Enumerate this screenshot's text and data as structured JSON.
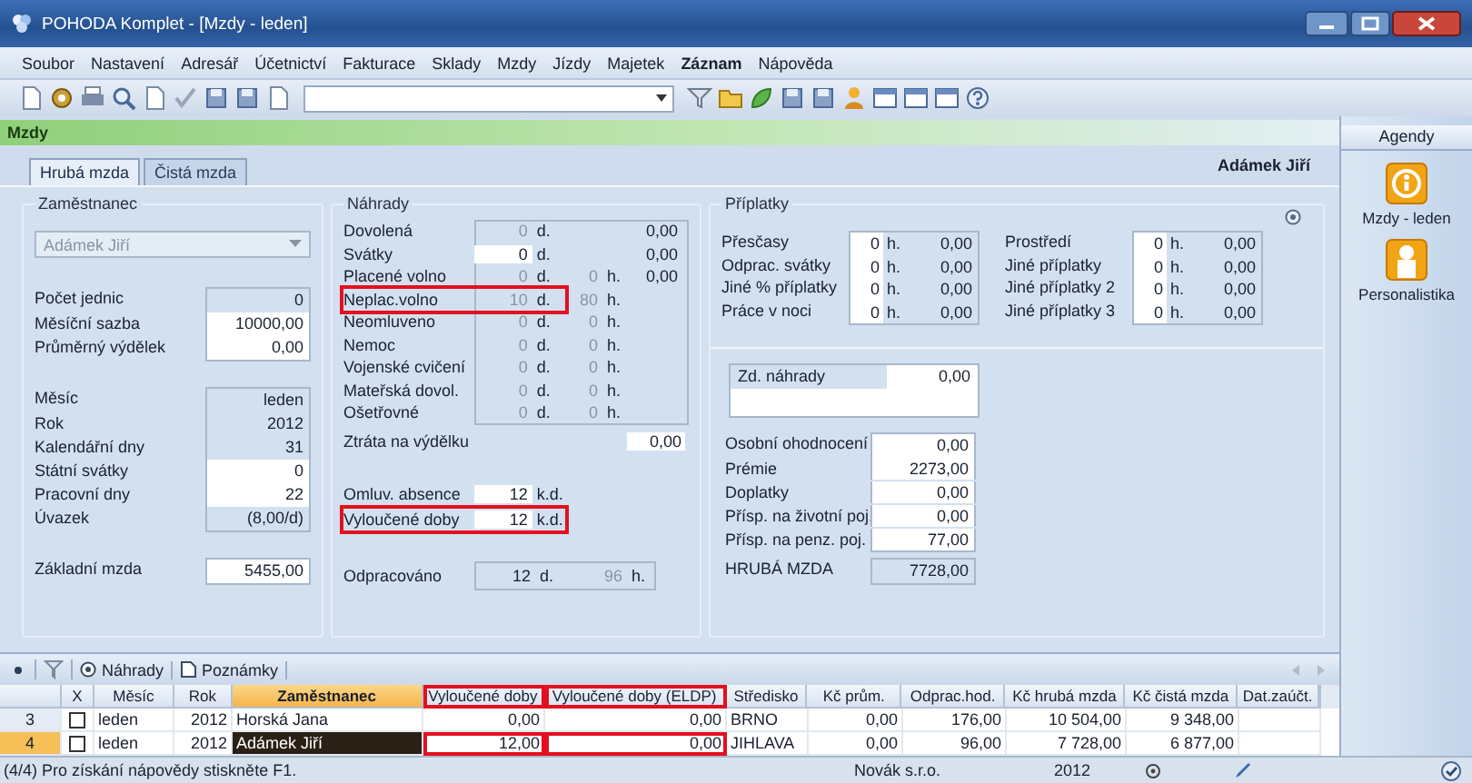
{
  "window": {
    "title": "POHODA Komplet - [Mzdy - leden]"
  },
  "menu": [
    {
      "label": "Soubor",
      "bold": false
    },
    {
      "label": "Nastavení",
      "bold": false
    },
    {
      "label": "Adresář",
      "bold": false
    },
    {
      "label": "Účetnictví",
      "bold": false
    },
    {
      "label": "Fakturace",
      "bold": false
    },
    {
      "label": "Sklady",
      "bold": false
    },
    {
      "label": "Mzdy",
      "bold": false
    },
    {
      "label": "Jízdy",
      "bold": false
    },
    {
      "label": "Majetek",
      "bold": false
    },
    {
      "label": "Záznam",
      "bold": true
    },
    {
      "label": "Nápověda",
      "bold": false
    }
  ],
  "agenda_header": "Mzdy",
  "tabs": [
    {
      "label": "Hrubá mzda",
      "selected": true
    },
    {
      "label": "Čistá mzda",
      "selected": false
    }
  ],
  "employee_name": "Adámek Jiří",
  "employee": {
    "title": "Zaměstnanec",
    "select_value": "Adámek Jiří",
    "fields_a": [
      {
        "label": "Počet jednic",
        "value": "0",
        "editable": false
      },
      {
        "label": "Měsíční sazba",
        "value": "10000,00",
        "editable": true
      },
      {
        "label": "Průměrný výdělek",
        "value": "0,00",
        "editable": true
      }
    ],
    "fields_b": [
      {
        "label": "Měsíc",
        "value": "leden",
        "editable": false
      },
      {
        "label": "Rok",
        "value": "2012",
        "editable": false
      },
      {
        "label": "Kalendářní dny",
        "value": "31",
        "editable": false
      },
      {
        "label": "Státní svátky",
        "value": "0",
        "editable": true
      },
      {
        "label": "Pracovní dny",
        "value": "22",
        "editable": true
      },
      {
        "label": "Úvazek",
        "value": "(8,00/d)",
        "editable": false
      }
    ],
    "base": {
      "label": "Základní mzda",
      "value": "5455,00"
    }
  },
  "compensation": {
    "title": "Náhrady",
    "rows": [
      {
        "label": "Dovolená",
        "days": "0",
        "day_unit": "d.",
        "amount": "0,00",
        "editable": false,
        "highlighted": false
      },
      {
        "label": "Svátky",
        "days": "0",
        "day_unit": "d.",
        "amount": "0,00",
        "editable": true,
        "highlighted": false
      },
      {
        "label": "Placené volno",
        "days": "0",
        "day_unit": "d.",
        "hours": "0",
        "hour_unit": "h.",
        "amount": "0,00",
        "editable": false,
        "highlighted": false
      },
      {
        "label": "Neplac.volno",
        "days": "10",
        "day_unit": "d.",
        "hours": "80",
        "hour_unit": "h.",
        "editable": false,
        "highlighted": true
      },
      {
        "label": "Neomluveno",
        "days": "0",
        "day_unit": "d.",
        "hours": "0",
        "hour_unit": "h.",
        "editable": false,
        "highlighted": false
      },
      {
        "label": "Nemoc",
        "days": "0",
        "day_unit": "d.",
        "hours": "0",
        "hour_unit": "h.",
        "editable": false,
        "highlighted": false
      },
      {
        "label": "Vojenské cvičení",
        "days": "0",
        "day_unit": "d.",
        "hours": "0",
        "hour_unit": "h.",
        "editable": false,
        "highlighted": false
      },
      {
        "label": "Mateřská dovol.",
        "days": "0",
        "day_unit": "d.",
        "hours": "0",
        "hour_unit": "h.",
        "editable": false,
        "highlighted": false
      },
      {
        "label": "Ošetřovné",
        "days": "0",
        "day_unit": "d.",
        "hours": "0",
        "hour_unit": "h.",
        "editable": false,
        "highlighted": false
      },
      {
        "label": "Ztráta na výdělku",
        "amount": "0,00",
        "editable": true,
        "highlighted": false
      }
    ],
    "absence": [
      {
        "label": "Omluv. absence",
        "days": "12",
        "unit": "k.d.",
        "highlighted": false
      },
      {
        "label": "Vyloučené doby",
        "days": "12",
        "unit": "k.d.",
        "highlighted": true
      }
    ],
    "worked": {
      "label": "Odpracováno",
      "days": "12",
      "day_unit": "d.",
      "hours": "96",
      "hour_unit": "h."
    }
  },
  "surcharges": {
    "title": "Příplatky",
    "columns": [
      [
        {
          "label": "Přesčasy",
          "hours": "0",
          "unit": "h.",
          "amount": "0,00"
        },
        {
          "label": "Odprac. svátky",
          "hours": "0",
          "unit": "h.",
          "amount": "0,00"
        },
        {
          "label": "Jiné % příplatky",
          "hours": "0",
          "unit": "h.",
          "amount": "0,00"
        },
        {
          "label": "Práce v noci",
          "hours": "0",
          "unit": "h.",
          "amount": "0,00"
        }
      ],
      [
        {
          "label": "Prostředí",
          "hours": "0",
          "unit": "h.",
          "amount": "0,00"
        },
        {
          "label": "Jiné příplatky",
          "hours": "0",
          "unit": "h.",
          "amount": "0,00"
        },
        {
          "label": "Jiné příplatky 2",
          "hours": "0",
          "unit": "h.",
          "amount": "0,00"
        },
        {
          "label": "Jiné příplatky 3",
          "hours": "0",
          "unit": "h.",
          "amount": "0,00"
        }
      ]
    ],
    "comp_total": {
      "label": "Zd. náhrady",
      "value": "0,00"
    },
    "totals": [
      {
        "label": "Osobní ohodnocení",
        "value": "0,00"
      },
      {
        "label": "Prémie",
        "value": "2273,00"
      },
      {
        "label": "Doplatky",
        "value": "0,00"
      },
      {
        "label": "Přísp. na životní poj.",
        "value": "0,00"
      },
      {
        "label": "Přísp. na penz. poj.",
        "value": "77,00"
      }
    ],
    "gross": {
      "label": "HRUBÁ MZDA",
      "value": "7728,00"
    }
  },
  "bottom_tabs": [
    {
      "label": "Náhrady",
      "kind": "circle"
    },
    {
      "label": "Poznámky",
      "kind": "note"
    }
  ],
  "table": {
    "checkbox_header": "X",
    "columns": [
      {
        "label": "Měsíc",
        "active": false,
        "highlighted": false
      },
      {
        "label": "Rok",
        "active": false,
        "highlighted": false
      },
      {
        "label": "Zaměstnanec",
        "active": true,
        "highlighted": false
      },
      {
        "label": "Vyloučené doby",
        "active": false,
        "highlighted": true
      },
      {
        "label": "Vyloučené doby (ELDP)",
        "active": false,
        "highlighted": true
      },
      {
        "label": "Středisko",
        "active": false,
        "highlighted": false
      },
      {
        "label": "Kč prům.",
        "active": false,
        "highlighted": false
      },
      {
        "label": "Odprac.hod.",
        "active": false,
        "highlighted": false
      },
      {
        "label": "Kč hrubá mzda",
        "active": false,
        "highlighted": false
      },
      {
        "label": "Kč čistá mzda",
        "active": false,
        "highlighted": false
      },
      {
        "label": "Dat.zaúčt.",
        "active": false,
        "highlighted": false
      }
    ],
    "rows": [
      {
        "number": "3",
        "checked": false,
        "selected": false,
        "highlighted": false,
        "cells": [
          "leden",
          "2012",
          "Horská Jana",
          "0,00",
          "0,00",
          "BRNO",
          "0,00",
          "176,00",
          "10 504,00",
          "9 348,00"
        ]
      },
      {
        "number": "4",
        "checked": false,
        "selected": true,
        "highlighted": true,
        "cells": [
          "leden",
          "2012",
          "Adámek Jiří",
          "12,00",
          "0,00",
          "JIHLAVA",
          "0,00",
          "96,00",
          "7 728,00",
          "6 877,00"
        ]
      }
    ]
  },
  "sidebar": {
    "title": "Agendy",
    "items": [
      {
        "label": "Mzdy - leden",
        "kind": "info"
      },
      {
        "label": "Personalistika",
        "kind": "person"
      }
    ]
  },
  "status_bar": {
    "hint": "(4/4) Pro získání nápovědy stiskněte F1.",
    "company": "Novák s.r.o.",
    "year": "2012"
  }
}
